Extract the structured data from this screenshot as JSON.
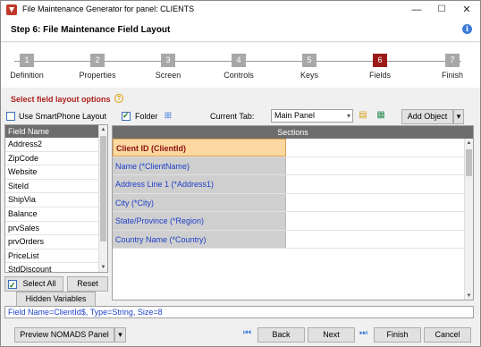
{
  "window": {
    "title": "File Maintenance Generator for panel: CLIENTS",
    "minimize": "—",
    "maximize": "☐",
    "close": "✕"
  },
  "header": {
    "title": "Step 6: File Maintenance Field Layout",
    "info_icon": "i"
  },
  "steps": [
    {
      "num": "1",
      "label": "Definition"
    },
    {
      "num": "2",
      "label": "Properties"
    },
    {
      "num": "3",
      "label": "Screen"
    },
    {
      "num": "4",
      "label": "Controls"
    },
    {
      "num": "5",
      "label": "Keys"
    },
    {
      "num": "6",
      "label": "Fields",
      "active": true
    },
    {
      "num": "7",
      "label": "Finish"
    }
  ],
  "options": {
    "title": "Select field layout options",
    "help_icon": "?",
    "smartphone_label": "Use SmartPhone Layout",
    "smartphone_checked": false,
    "folder_label": "Folder",
    "folder_checked": true,
    "current_tab_label": "Current Tab:",
    "current_tab_value": "Main Panel",
    "add_object_label": "Add Object"
  },
  "field_list": {
    "header": "Field Name",
    "items": [
      "Address2",
      "ZipCode",
      "Website",
      "SiteId",
      "ShipVia",
      "Balance",
      "prvSales",
      "prvOrders",
      "PriceList",
      "StdDiscount"
    ]
  },
  "list_buttons": {
    "select_all": "Select All",
    "select_all_checked": true,
    "reset": "Reset",
    "hidden_variables": "Hidden Variables"
  },
  "sections": {
    "header": "Sections",
    "rows": [
      {
        "label": "Client ID (ClientId)",
        "selected": true
      },
      {
        "label": "Name (*ClientName)"
      },
      {
        "label": "Address Line 1 (*Address1)"
      },
      {
        "label": "City (*City)"
      },
      {
        "label": "State/Province (*Region)"
      },
      {
        "label": "Country Name (*Country)"
      }
    ]
  },
  "status": {
    "text": "Field Name=ClientId$, Type=String, Size=8"
  },
  "footer": {
    "preview_label": "Preview NOMADS Panel",
    "back_label": "Back",
    "next_label": "Next",
    "finish_label": "Finish",
    "cancel_label": "Cancel"
  }
}
